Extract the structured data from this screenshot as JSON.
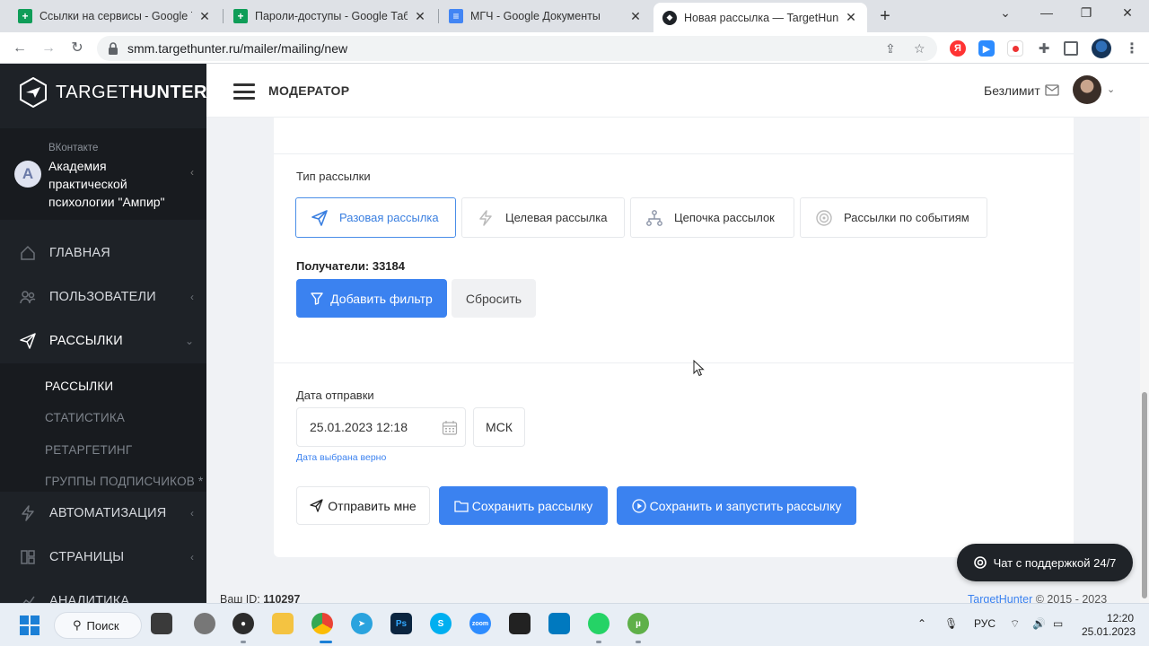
{
  "browser": {
    "tabs": [
      {
        "title": "Ссылки на сервисы - Google Табл",
        "icon": "google-sheets-icon",
        "active": false
      },
      {
        "title": "Пароли-доступы - Google Табли",
        "icon": "google-sheets-icon",
        "active": false
      },
      {
        "title": "МГЧ - Google Документы",
        "icon": "google-docs-icon",
        "active": false
      },
      {
        "title": "Новая рассылка — TargetHunter",
        "icon": "targethunter-icon",
        "active": true
      }
    ],
    "url": "smm.targethunter.ru/mailer/mailing/new"
  },
  "brand": {
    "prefix": "TARGET",
    "bold": "HUNTER"
  },
  "account": {
    "network": "ВКонтакте",
    "name": "Академия практической психологии \"Ампир\"",
    "avatar_letter": "А"
  },
  "sidebar": {
    "items": [
      {
        "label": "ГЛАВНАЯ",
        "icon": "home-icon"
      },
      {
        "label": "ПОЛЬЗОВАТЕЛИ",
        "icon": "users-icon"
      },
      {
        "label": "РАССЫЛКИ",
        "icon": "send-icon"
      },
      {
        "label": "АВТОМАТИЗАЦИЯ",
        "icon": "lightning-icon"
      },
      {
        "label": "СТРАНИЦЫ",
        "icon": "pages-icon"
      },
      {
        "label": "АНАЛИТИКА",
        "icon": "analytics-icon"
      }
    ],
    "submenu": [
      "РАССЫЛКИ",
      "СТАТИСТИКА",
      "РЕТАРГЕТИНГ",
      "ГРУППЫ ПОДПИСЧИКОВ *"
    ]
  },
  "header": {
    "role": "МОДЕРАТОР",
    "plan": "Безлимит"
  },
  "mailing": {
    "type_label": "Тип рассылки",
    "types": [
      {
        "label": "Разовая рассылка",
        "icon": "send-icon"
      },
      {
        "label": "Целевая рассылка",
        "icon": "lightning-icon"
      },
      {
        "label": "Цепочка рассылок",
        "icon": "chain-icon"
      },
      {
        "label": "Рассылки по событиям",
        "icon": "events-icon"
      }
    ],
    "recipients": "Получатели: 33184",
    "add_filter": "Добавить фильтр",
    "reset": "Сбросить",
    "date_label": "Дата отправки",
    "date_value": "25.01.2023 12:18",
    "timezone": "МСК",
    "date_hint": "Дата выбрана верно",
    "send_me": "Отправить мне",
    "save": "Сохранить рассылку",
    "save_run": "Сохранить и запустить рассылку"
  },
  "footer": {
    "id_label": "Ваш ID:",
    "id_value": "110297",
    "brand": "TargetHunter",
    "copy": "© 2015 - 2023"
  },
  "chat": {
    "label": "Чат с поддержкой 24/7"
  },
  "taskbar": {
    "search": "Поиск",
    "lang": "РУС",
    "time": "12:20",
    "date": "25.01.2023"
  }
}
